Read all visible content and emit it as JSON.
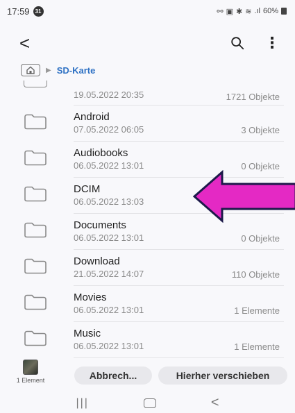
{
  "status_bar": {
    "time": "17:59",
    "notification_count": "31",
    "battery": "60%"
  },
  "app_bar": {
    "icons": [
      "back-arrow-icon",
      "search-icon",
      "more-vertical-icon"
    ]
  },
  "breadcrumb": {
    "path": [
      "SD-Karte"
    ]
  },
  "partial_item": {
    "date": "19.05.2022 20:35",
    "count": "1721 Objekte"
  },
  "items": [
    {
      "name": "Android",
      "date": "07.05.2022 06:05",
      "count": "3 Objekte"
    },
    {
      "name": "Audiobooks",
      "date": "06.05.2022 13:01",
      "count": "0 Objekte"
    },
    {
      "name": "DCIM",
      "date": "06.05.2022 13:03",
      "count": ""
    },
    {
      "name": "Documents",
      "date": "06.05.2022 13:01",
      "count": "0 Objekte"
    },
    {
      "name": "Download",
      "date": "21.05.2022 14:07",
      "count": "110 Objekte"
    },
    {
      "name": "Movies",
      "date": "06.05.2022 13:01",
      "count": "1 Elemente"
    },
    {
      "name": "Music",
      "date": "06.05.2022 13:01",
      "count": "1 Elemente"
    }
  ],
  "bottom_bar": {
    "selection_label": "1 Element",
    "cancel_label": "Abbrech...",
    "move_label": "Hierher verschieben"
  },
  "colors": {
    "accent": "#2f72c4",
    "callout_fill": "#e429c4",
    "callout_stroke": "#1d1a4a"
  }
}
